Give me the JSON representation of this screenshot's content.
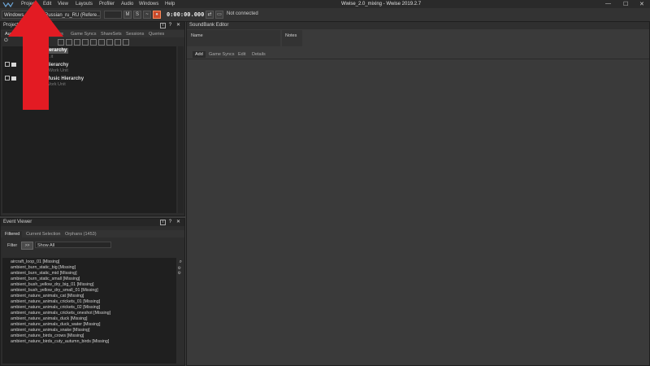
{
  "menubar": {
    "items": [
      "Project",
      "Edit",
      "View",
      "Layouts",
      "Profiler",
      "Audio",
      "Windows",
      "Help"
    ],
    "title": "Wwise_2.0_mixing - Wwise 2019.2.7",
    "window_controls": [
      "—",
      "☐",
      "✕"
    ]
  },
  "toolbar": {
    "platform": "Windows_Hi…",
    "language": "Russian_ru_RU (Refere…",
    "time": "0:00:00.000",
    "status": "Not connected"
  },
  "project_explorer": {
    "title": "Project Ex…",
    "tabs": [
      "Audio",
      "…ndBanks",
      "Game Syncs",
      "ShareSets",
      "Sessions",
      "Queries"
    ],
    "tree": [
      {
        "label": "…ierarchy",
        "sub": "",
        "selected": true
      },
      {
        "label": "",
        "sub": "…it",
        "selected": false
      },
      {
        "label": "…e Hierarchy",
        "sub": "",
        "selected": false
      },
      {
        "label": "",
        "sub": "…ult Work Unit",
        "selected": false
      },
      {
        "label": "…e Music Hierarchy",
        "sub": "",
        "selected": false
      },
      {
        "label": "",
        "sub": "…lt Work Unit",
        "selected": false
      }
    ]
  },
  "soundbank_editor": {
    "title": "SoundBank Editor",
    "col_name": "Name",
    "col_notes": "Notes",
    "tabs": [
      "Add",
      "Game Syncs",
      "Edit",
      "Details"
    ]
  },
  "event_viewer": {
    "title": "Event Viewer",
    "tabs": [
      "Filtered",
      "Current Selection",
      "Orphans (1453)"
    ],
    "filter_label": "Filter",
    "filter_button": ">>",
    "filter_value": "Show All",
    "events": [
      "aircraft_loop_01 [Missing]",
      "ambient_burn_static_big [Missing]",
      "ambient_burn_static_mid [Missing]",
      "ambient_burn_static_small [Missing]",
      "ambient_bush_yellow_dry_big_01 [Missing]",
      "ambient_bush_yellow_dry_small_01 [Missing]",
      "ambient_nature_animals_cat [Missing]",
      "ambient_nature_animals_crickets_01 [Missing]",
      "ambient_nature_animals_crickets_02 [Missing]",
      "ambient_nature_animals_crickets_oneshot [Missing]",
      "ambient_nature_animals_duck [Missing]",
      "ambient_nature_animals_duck_water [Missing]",
      "ambient_nature_animals_snake [Missing]",
      "ambient_nature_birds_crows [Missing]",
      "ambient_nature_birds_cuty_autumn_birds [Missing]"
    ]
  },
  "colors": {
    "accent": "#e31b23",
    "panel": "#2d2d2d",
    "bg": "#3c3c3c"
  }
}
